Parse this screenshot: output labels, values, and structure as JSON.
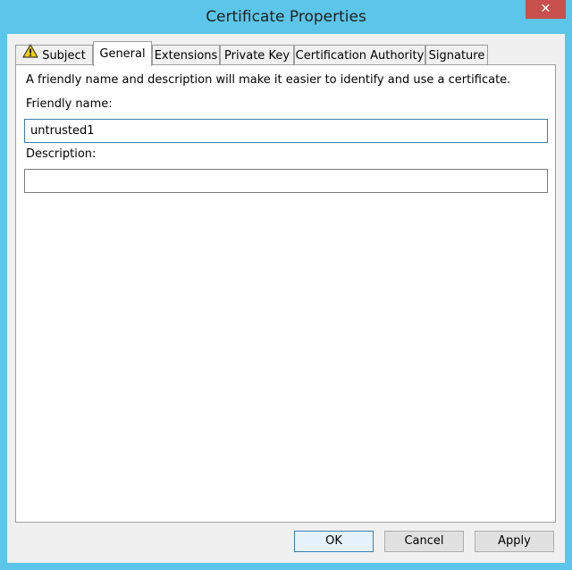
{
  "window": {
    "title": "Certificate Properties",
    "close_glyph": "✕"
  },
  "tabs": [
    {
      "label": "Subject",
      "icon": "warning-icon",
      "active": false
    },
    {
      "label": "General",
      "active": true
    },
    {
      "label": "Extensions",
      "active": false
    },
    {
      "label": "Private Key",
      "active": false
    },
    {
      "label": "Certification Authority",
      "active": false
    },
    {
      "label": "Signature",
      "active": false
    }
  ],
  "general": {
    "intro": "A friendly name and description will make it easier to identify and use a certificate.",
    "friendly_name_label": "Friendly name:",
    "friendly_name_value": "untrusted1",
    "description_label": "Description:",
    "description_value": ""
  },
  "buttons": {
    "ok": "OK",
    "cancel": "Cancel",
    "apply": "Apply"
  },
  "colors": {
    "title_bar": "#5bc6ea",
    "close_button": "#c7504c",
    "focus_border": "#3c7fb1"
  }
}
